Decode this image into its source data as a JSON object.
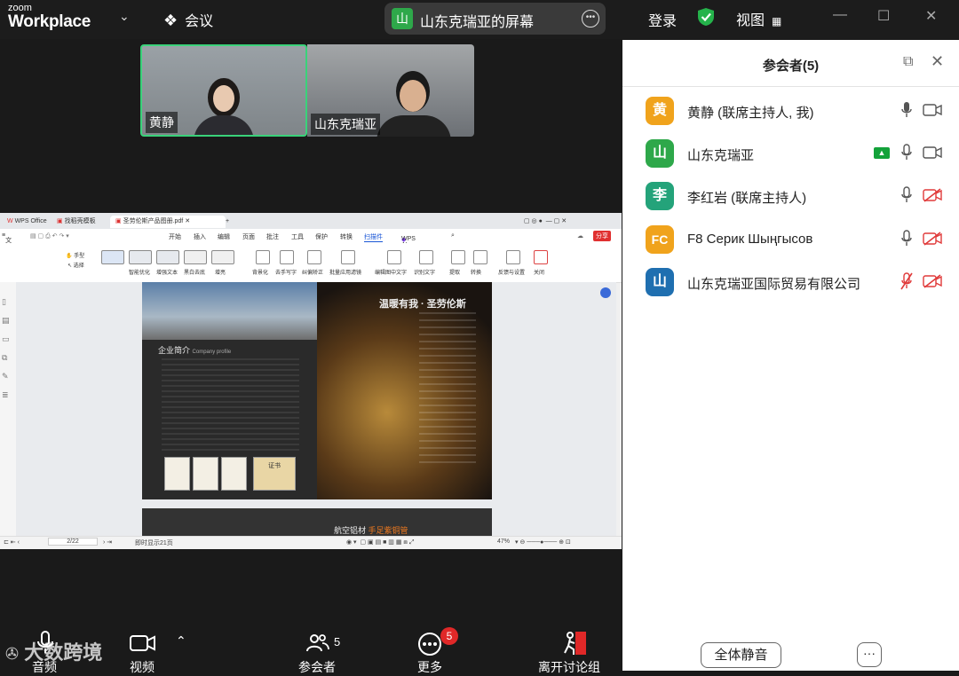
{
  "app": {
    "brand_small": "zoom",
    "brand_big": "Workplace"
  },
  "topbar": {
    "meeting_label": "会议",
    "share_title": "山东克瑞亚的屏幕",
    "share_avatar": "山",
    "login_label": "登录",
    "view_label": "视图"
  },
  "videos": [
    {
      "name": "黄静"
    },
    {
      "name": "山东克瑞亚"
    }
  ],
  "wps": {
    "tabs": [
      "WPS Office",
      "找稻壳模板",
      "圣劳伦斯产品图册.pdf"
    ],
    "menu": [
      "开始",
      "插入",
      "编辑",
      "页面",
      "批注",
      "工具",
      "保护",
      "转换",
      "扫描件",
      "WPS AI"
    ],
    "menu_file": "文件",
    "share_btn": "分享",
    "ribbon_left": [
      "手型",
      "选择"
    ],
    "ribbon": [
      "智能优化",
      "增强文本",
      "黑白去底",
      "增亮",
      "背景化",
      "去手写字",
      "纠偏矫正",
      "批量应用滤镜",
      "编辑图中文字",
      "识别文字",
      "提取",
      "转换",
      "反馈与设置",
      "关闭"
    ],
    "page1_title": "温暖有我 · 圣劳伦斯",
    "page1_section": "企业简介",
    "page1_section_en": "Company profile",
    "page1_cert": "证书",
    "page2_title": "航空铝材",
    "page2_sub": "手足紫铜管",
    "status_page": "2/22",
    "status_total": "即时显示21页",
    "status_zoom": "47%"
  },
  "panel": {
    "title": "参会者(5)",
    "participants": [
      {
        "avatar": "黄",
        "name": "黄静 (联席主持人, 我)",
        "color": "#f0a31c",
        "mic": "on",
        "cam": "off",
        "sharing": false
      },
      {
        "avatar": "山",
        "name": "山东克瑞亚",
        "color": "#2ea84a",
        "mic": "on",
        "cam": "off",
        "sharing": true
      },
      {
        "avatar": "李",
        "name": "李红岩 (联席主持人)",
        "color": "#24a37a",
        "mic": "on",
        "cam": "muted",
        "sharing": false
      },
      {
        "avatar": "FC",
        "name": "F8 Серик Шыңгысов",
        "color": "#f0a31c",
        "mic": "on",
        "cam": "muted",
        "sharing": false
      },
      {
        "avatar": "山",
        "name": "山东克瑞亚国际贸易有限公司",
        "color": "#1f6fb0",
        "mic": "muted",
        "cam": "muted",
        "sharing": false
      }
    ],
    "mute_all": "全体静音",
    "more": "···"
  },
  "toolbar": {
    "audio": "音频",
    "video": "视频",
    "participants": "参会者",
    "participants_count": "5",
    "more": "更多",
    "more_badge": "5",
    "leave": "离开讨论组"
  },
  "watermark": "大数跨境",
  "colors": {
    "accent_green": "#2ea84a",
    "highlight_border": "#3ad27a",
    "danger": "#e02828"
  }
}
